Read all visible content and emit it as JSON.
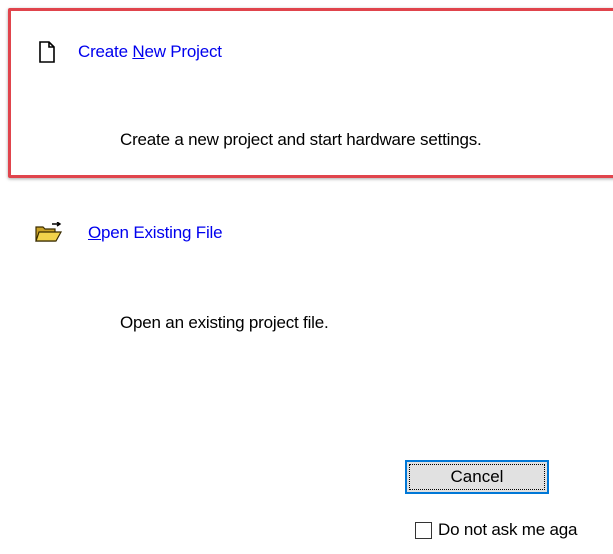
{
  "options": {
    "create": {
      "label_pre": "Create ",
      "label_key": "N",
      "label_post": "ew Project",
      "description": "Create a new project and start hardware settings."
    },
    "open": {
      "label_pre": "",
      "label_key": "O",
      "label_post": "pen Existing File",
      "description": "Open an existing project file."
    }
  },
  "buttons": {
    "cancel_label": "Cancel"
  },
  "checkbox": {
    "label": "Do not ask me aga",
    "checked": false
  },
  "colors": {
    "link": "#0000ee",
    "highlight": "#e0444c",
    "focus": "#0078d7"
  },
  "icons": {
    "create": "new-document-icon",
    "open": "open-folder-icon"
  }
}
